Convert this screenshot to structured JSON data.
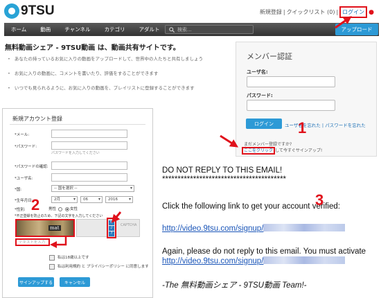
{
  "header": {
    "logo_text": "9TSU",
    "links": {
      "register": "新規登録",
      "quicklist": "クイックリスト (0)",
      "login": "ログイン"
    }
  },
  "nav": {
    "items": [
      "ホーム",
      "動画",
      "チャンネル",
      "カテゴリ",
      "アダルト"
    ],
    "search_placeholder": "検索...",
    "upload": "アップロード"
  },
  "intro": {
    "tagline": "無料動画シェア - 9TSU動画 は、動画共有サイトです。",
    "bullets": [
      "あなたの持っているお気に入りの動画をアップロードして、世界中の人たちと共有しましょう",
      "お気に入りの動画に、コメントを書いたり、評価をすることができます",
      "いつでも見られるように、お気に入りの動画を、プレイリストに登録することができます"
    ]
  },
  "auth": {
    "title": "メンバー認証",
    "username_label": "ユーザ名:",
    "password_label": "パスワード:",
    "login_button": "ログイン",
    "forgot": "ユーザ名を忘れた | パスワードを忘れた",
    "not_member": "まだメンバー登録ですか?",
    "click_here": "ここをクリック",
    "signup_suffix": "して今すぐサインアップ!"
  },
  "register": {
    "title": "新規アカウント登録",
    "email_label": "*メール:",
    "password_label": "*パスワード:",
    "password_hint": "パスワードを入力してください",
    "confirm_label": "*パスワードの確認:",
    "username_label": "*ユーザ名:",
    "country_label": "*国:",
    "country_value": "-- 国を選択 --",
    "birthday_label": "*生年月日:",
    "birth_month": "2月",
    "birth_day": "06",
    "birth_year": "2016",
    "gender_label": "*性別:",
    "gender_male": "男性",
    "gender_female": "女性",
    "captcha_label": "*不正登録を防止のため、下記の文字を入力してください",
    "captcha_word": "mat",
    "captcha_placeholder": "テキストを入力",
    "captcha_brand": "CAPTCHA",
    "age_check": "私は18歳以上です",
    "terms_check": "私は利用規約 と プライバシーポリシー に同意します",
    "signup_button": "サインアップする",
    "cancel_button": "キャンセル"
  },
  "email": {
    "heading": "DO NOT REPLY TO THIS EMAIL!",
    "stars": "****************************************",
    "instruction": "Click the following link to get your account verified:",
    "link1": "http://video.9tsu.com/signup/",
    "again": "Again, please do not reply to this email. You must activate",
    "link2": "http://video.9tsu.com/signup/",
    "signature": "-The 無料動画シェア - 9TSU動画 Team!-"
  },
  "annotations": {
    "step1": "1",
    "step2": "2",
    "step3": "3"
  },
  "colors": {
    "accent": "#2d9ad6",
    "annotation": "#e0111b",
    "nav": "#3f3f3f",
    "link": "#1a55b8"
  }
}
